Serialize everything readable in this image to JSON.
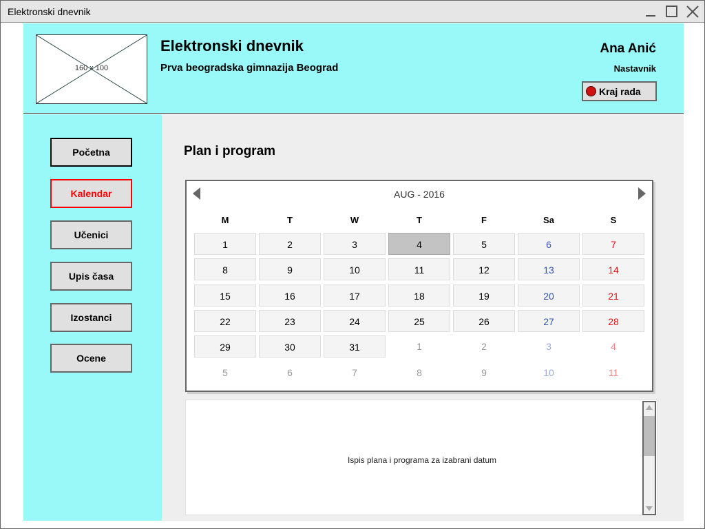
{
  "window": {
    "title": "Elektronski dnevnik"
  },
  "header": {
    "logo_placeholder": "160 x 100",
    "app_title": "Elektronski dnevnik",
    "school": "Prva beogradska gimnazija Beograd",
    "user_name": "Ana Anić",
    "user_role": "Nastavnik",
    "logout_label": "Kraj rada"
  },
  "sidebar": {
    "items": [
      {
        "label": "Početna"
      },
      {
        "label": "Kalendar"
      },
      {
        "label": "Učenici"
      },
      {
        "label": "Upis časa"
      },
      {
        "label": "Izostanci"
      },
      {
        "label": "Ocene"
      }
    ],
    "current": "Kalendar"
  },
  "main": {
    "page_title": "Plan i program",
    "calendar": {
      "month_label": "AUG - 2016",
      "weekdays": [
        "M",
        "T",
        "W",
        "T",
        "F",
        "Sa",
        "S"
      ],
      "weeks": [
        [
          1,
          2,
          3,
          4,
          5,
          6,
          7
        ],
        [
          8,
          9,
          10,
          11,
          12,
          13,
          14
        ],
        [
          15,
          16,
          17,
          18,
          19,
          20,
          21
        ],
        [
          22,
          23,
          24,
          25,
          26,
          27,
          28
        ],
        [
          29,
          30,
          31,
          1,
          2,
          3,
          4
        ],
        [
          5,
          6,
          7,
          8,
          9,
          10,
          11
        ]
      ],
      "selected_day": 4,
      "days_in_month": 31
    },
    "plan_text": "Ispis plana i programa za izabrani datum"
  },
  "colors": {
    "accent_bg": "#99f8f8",
    "current_nav": "#ff0000",
    "saturday": "#3355bb",
    "sunday": "#dd1111"
  }
}
